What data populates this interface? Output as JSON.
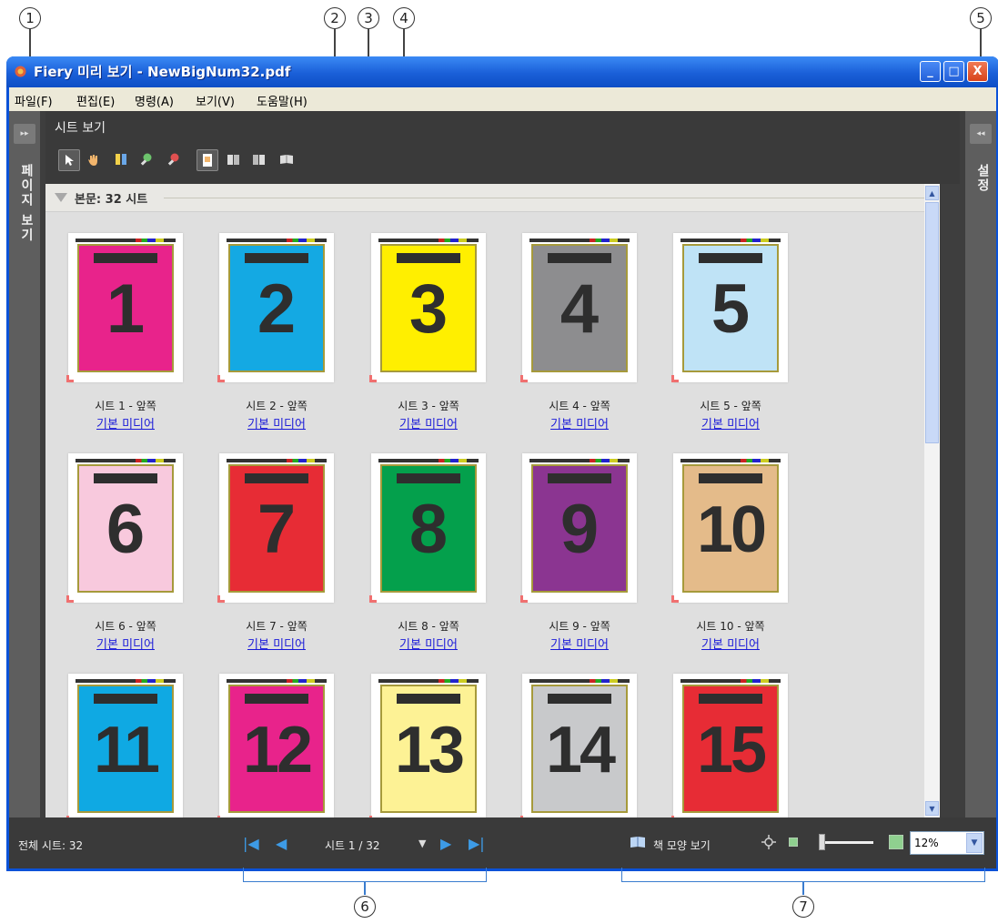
{
  "callouts": [
    "1",
    "2",
    "3",
    "4",
    "5",
    "6",
    "7"
  ],
  "window": {
    "title": "Fiery 미리 보기 - NewBigNum32.pdf",
    "minimize": "_",
    "maximize": "□",
    "close": "X"
  },
  "menu": [
    "파일(F)",
    "편집(E)",
    "명령(A)",
    "보기(V)",
    "도움말(H)"
  ],
  "left_panel": {
    "toggle": "▸▸",
    "label": "페이지 보기"
  },
  "right_panel": {
    "toggle": "◂◂",
    "label": "설정"
  },
  "sheet_view": {
    "title": "시트 보기",
    "tools": [
      "select-arrow",
      "hand-pan",
      "split-icon",
      "zoom-in",
      "zoom-out",
      "page-icon",
      "insert-before",
      "insert-after",
      "book-icon"
    ]
  },
  "section": {
    "title": "본문: 32 시트"
  },
  "sheets": [
    {
      "num": "1",
      "color": "#e8238b",
      "label": "시트 1 - 앞쪽",
      "media": "기본 미디어"
    },
    {
      "num": "2",
      "color": "#14a9e3",
      "label": "시트 2 - 앞쪽",
      "media": "기본 미디어"
    },
    {
      "num": "3",
      "color": "#ffef00",
      "label": "시트 3 - 앞쪽",
      "media": "기본 미디어"
    },
    {
      "num": "4",
      "color": "#8d8d8f",
      "label": "시트 4 - 앞쪽",
      "media": "기본 미디어"
    },
    {
      "num": "5",
      "color": "#bfe3f6",
      "label": "시트 5 - 앞쪽",
      "media": "기본 미디어"
    },
    {
      "num": "6",
      "color": "#f8c9dd",
      "label": "시트 6 - 앞쪽",
      "media": "기본 미디어"
    },
    {
      "num": "7",
      "color": "#e72c35",
      "label": "시트 7 - 앞쪽",
      "media": "기본 미디어"
    },
    {
      "num": "8",
      "color": "#04a04c",
      "label": "시트 8 - 앞쪽",
      "media": "기본 미디어"
    },
    {
      "num": "9",
      "color": "#8b3591",
      "label": "시트 9 - 앞쪽",
      "media": "기본 미디어"
    },
    {
      "num": "10",
      "color": "#e4bb8a",
      "label": "시트 10 - 앞쪽",
      "media": "기본 미디어"
    },
    {
      "num": "11",
      "color": "#0fa9e3",
      "label": "",
      "media": ""
    },
    {
      "num": "12",
      "color": "#e8238b",
      "label": "",
      "media": ""
    },
    {
      "num": "13",
      "color": "#fdf295",
      "label": "",
      "media": ""
    },
    {
      "num": "14",
      "color": "#c8c9cb",
      "label": "",
      "media": ""
    },
    {
      "num": "15",
      "color": "#e72c35",
      "label": "",
      "media": ""
    }
  ],
  "status": {
    "total_sheets": "전체 시트: 32",
    "sheet_pos": "시트 1 / 32",
    "book_view": "책 모양 보기",
    "zoom": "12%"
  }
}
